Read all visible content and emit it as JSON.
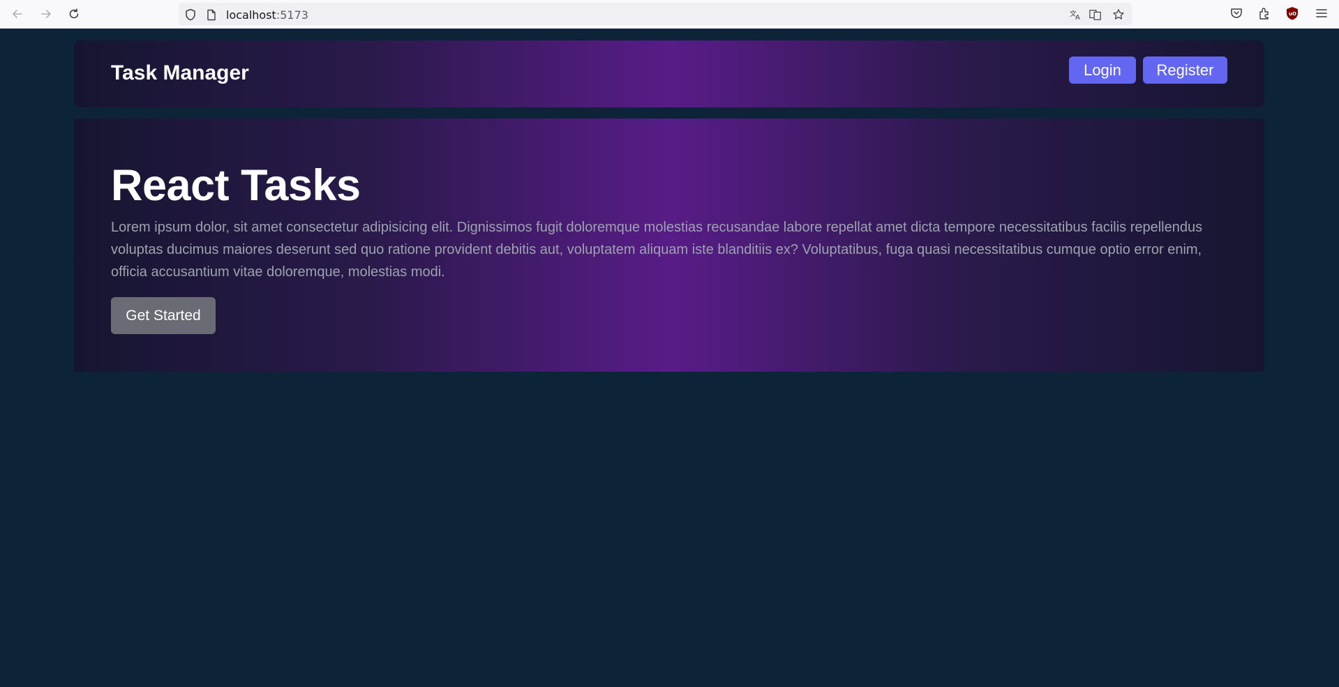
{
  "browser": {
    "url_host": "localhost",
    "url_port": ":5173",
    "icons": [
      "back-arrow-icon",
      "forward-arrow-icon",
      "reload-icon",
      "shield-icon",
      "page-icon",
      "translate-icon",
      "reader-icon",
      "bookmark-star-icon",
      "pocket-icon",
      "extensions-icon",
      "ublock-icon",
      "menu-icon"
    ]
  },
  "navbar": {
    "brand": "Task Manager",
    "login_label": "Login",
    "register_label": "Register"
  },
  "hero": {
    "title": "React Tasks",
    "description": "Lorem ipsum dolor, sit amet consectetur adipisicing elit. Dignissimos fugit doloremque molestias recusandae labore repellat amet dicta tempore necessitatibus facilis repellendus voluptas ducimus maiores deserunt sed quo ratione provident debitis aut, voluptatem aliquam iste blanditiis ex? Voluptatibus, fuga quasi necessitatibus cumque optio error enim, officia accusantium vitae doloremque, molestias modi.",
    "cta_label": "Get Started"
  },
  "colors": {
    "page_bg": "#0d2438",
    "accent": "#6366f1",
    "gradient_center": "#581c87",
    "gradient_edge": "#161530",
    "muted_text": "#9ca3af",
    "cta_bg": "#6b6b75"
  }
}
